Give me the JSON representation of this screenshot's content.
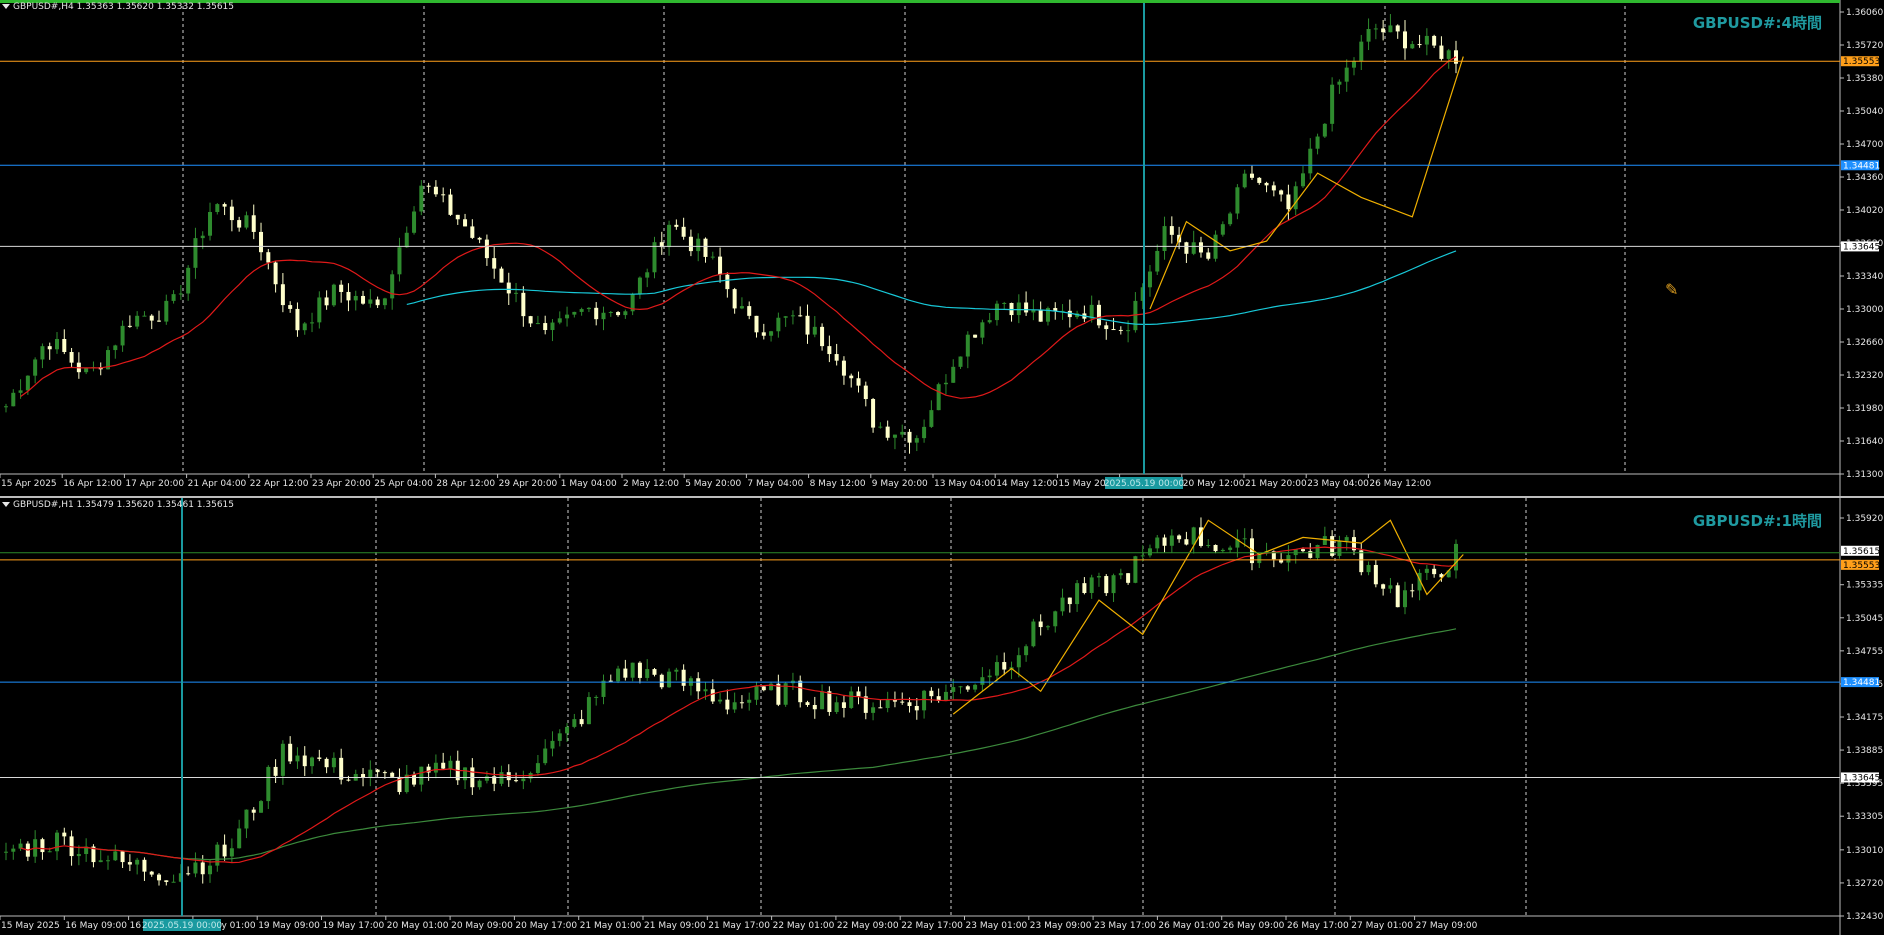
{
  "panes": [
    {
      "id": "h4",
      "header": "GBPUSD#,H4  1.35363 1.35620 1.35332 1.35615",
      "watermark": "GBPUSD#:4時間",
      "price_ticks": [
        "1.36060",
        "1.35720",
        "1.35380",
        "1.35040",
        "1.34700",
        "1.34360",
        "1.34020",
        "1.33680",
        "1.33340",
        "1.33000",
        "1.32660",
        "1.32320",
        "1.31980",
        "1.31640",
        "1.31300"
      ],
      "time_ticks": [
        "15 Apr 2025",
        "16 Apr 12:00",
        "17 Apr 20:00",
        "21 Apr 04:00",
        "22 Apr 12:00",
        "23 Apr 20:00",
        "25 Apr 04:00",
        "28 Apr 12:00",
        "29 Apr 20:00",
        "1 May 04:00",
        "2 May 12:00",
        "5 May 20:00",
        "7 May 04:00",
        "8 May 12:00",
        "9 May 20:00",
        "13 May 04:00",
        "14 May 12:00",
        "15 May 20:00",
        "20 May 04:00",
        "20 May 12:00",
        "21 May 20:00",
        "23 May 04:00",
        "26 May 12:00"
      ],
      "cursor_time_label": "2025.05.19 00:00",
      "hlines": [
        {
          "price": "1.35553",
          "color": "#ff9f1a",
          "tag_bg": "#ff9f1a",
          "tag_fg": "#000000"
        },
        {
          "price": "1.34481",
          "color": "#1e90ff",
          "tag_bg": "#1e90ff",
          "tag_fg": "#ffffff"
        },
        {
          "price": "1.33645",
          "color": "#d9d9d9",
          "tag_bg": "#ffffff",
          "tag_fg": "#000000"
        }
      ]
    },
    {
      "id": "h1",
      "header": "GBPUSD#,H1  1.35479 1.35620 1.35461 1.35615",
      "watermark": "GBPUSD#:1時間",
      "price_ticks": [
        "1.35920",
        "1.35335",
        "1.35045",
        "1.34755",
        "1.34465",
        "1.34175",
        "1.33885",
        "1.33595",
        "1.33305",
        "1.33010",
        "1.32720",
        "1.32430"
      ],
      "time_ticks": [
        "15 May 2025",
        "16 May 09:00",
        "16 May",
        "19 May 01:00",
        "19 May 09:00",
        "19 May 17:00",
        "20 May 01:00",
        "20 May 09:00",
        "20 May 17:00",
        "21 May 01:00",
        "21 May 09:00",
        "21 May 17:00",
        "22 May 01:00",
        "22 May 09:00",
        "22 May 17:00",
        "23 May 01:00",
        "23 May 09:00",
        "23 May 17:00",
        "26 May 01:00",
        "26 May 09:00",
        "26 May 17:00",
        "27 May 01:00",
        "27 May 09:00"
      ],
      "cursor_time_label": "2025.05.19 00:00",
      "hlines": [
        {
          "price": "1.35615",
          "color": "#2a8a2a",
          "tag_bg": "#ffffff",
          "tag_fg": "#000000"
        },
        {
          "price": "1.35553",
          "color": "#ff9f1a",
          "tag_bg": "#ff9f1a",
          "tag_fg": "#000000"
        },
        {
          "price": "1.34481",
          "color": "#1e90ff",
          "tag_bg": "#1e90ff",
          "tag_fg": "#ffffff"
        },
        {
          "price": "1.33645",
          "color": "#d9d9d9",
          "tag_bg": "#ffffff",
          "tag_fg": "#000000"
        }
      ]
    }
  ],
  "colors": {
    "background": "#000000",
    "candle_bull": "#2e8b2e",
    "candle_bear": "#ffffcc",
    "ma_fast": "#e01919",
    "ma_slow_h4": "#18c8d8",
    "ma_slow_h1": "#3c8a3c",
    "zigzag": "#f0b000",
    "cursor_line": "#1a9aa0",
    "top_bar": "#2fb82f"
  },
  "icons": {
    "pane_menu": "triangle-down-icon",
    "cursor": "crosshair-pencil-icon"
  }
}
